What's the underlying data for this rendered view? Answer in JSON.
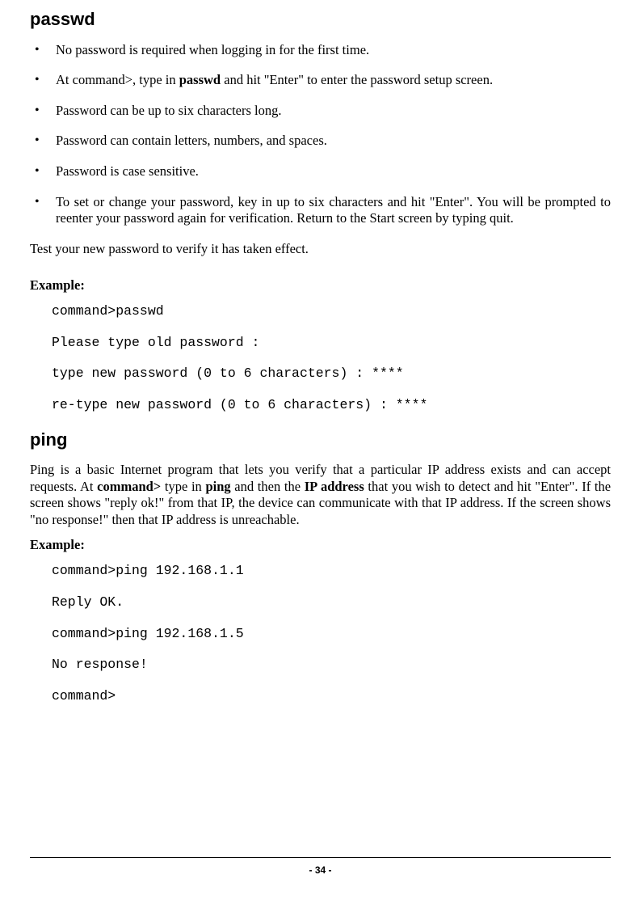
{
  "section1": {
    "heading": "passwd",
    "bullets": [
      {
        "pre": "No password is required when logging in for the first time."
      },
      {
        "pre": "At command>, type in ",
        "bold": "passwd",
        "post": " and hit \"Enter\" to enter the password setup screen."
      },
      {
        "pre": "Password can be up to six characters long."
      },
      {
        "pre": "Password can contain letters, numbers, and spaces."
      },
      {
        "pre": "Password is case sensitive."
      },
      {
        "pre": "To set or change your password, key in up to six characters and hit \"Enter\". You will be prompted to reenter your password again for verification. Return to the Start screen by typing quit."
      }
    ],
    "para": "Test your new password to verify it has taken effect.",
    "exampleLabel": "Example:",
    "code": [
      "command>passwd",
      "Please type old password :",
      "type new password (0 to 6 characters) : ****",
      "re-type new password (0 to 6 characters) : ****"
    ]
  },
  "section2": {
    "heading": "ping",
    "para": {
      "p1": "Ping is a basic Internet program that lets you verify that a particular IP address exists and can accept requests. At ",
      "b1": "command>",
      "p2": " type in ",
      "b2": "ping",
      "p3": " and then the ",
      "b3": "IP address",
      "p4": " that you wish to detect and hit \"Enter\". If the screen shows \"reply ok!\" from that IP, the device can communicate with that IP address. If the screen shows \"no response!\" then that IP address is unreachable."
    },
    "exampleLabel": "Example:",
    "code": [
      "command>ping 192.168.1.1",
      "Reply OK.",
      "command>ping 192.168.1.5",
      "No response!",
      "command>"
    ]
  },
  "footer": "- 34 -"
}
